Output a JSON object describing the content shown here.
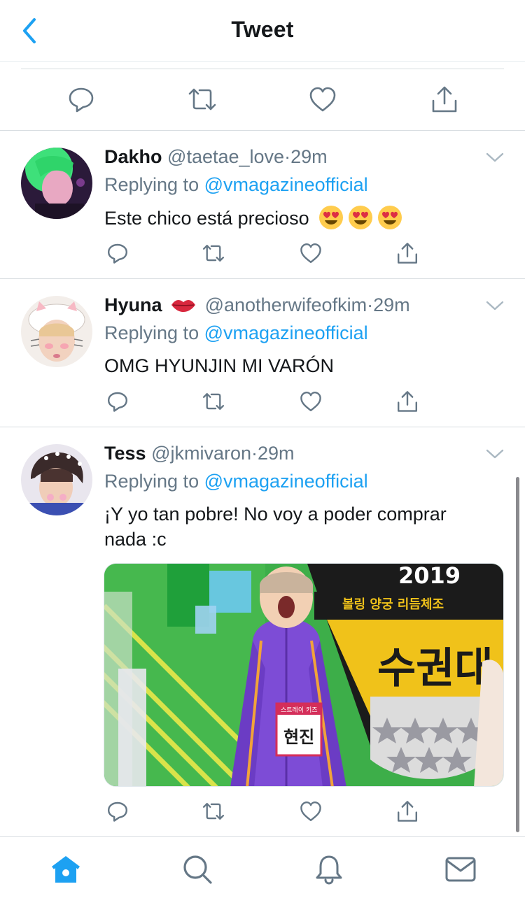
{
  "header": {
    "title": "Tweet"
  },
  "colors": {
    "accent": "#1da1f2",
    "muted": "#657786",
    "text": "#14171a",
    "divider": "#d8dde1"
  },
  "main_actions": [
    "reply-icon",
    "retweet-icon",
    "like-icon",
    "share-icon"
  ],
  "tweets": [
    {
      "name": "Dakho",
      "handle": "@taetae_love",
      "dot": "·",
      "time": "29m",
      "replying_prefix": "Replying to",
      "mention": "@vmagazineofficial",
      "text": "Este chico está precioso",
      "emojis": [
        "heart-eyes-emoji",
        "heart-eyes-emoji",
        "heart-eyes-emoji"
      ]
    },
    {
      "name": "Hyuna",
      "name_emoji": "lips-emoji",
      "handle": "@anotherwifeofkim",
      "dot": "·",
      "time": "29m",
      "replying_prefix": "Replying to",
      "mention": "@vmagazineofficial",
      "text": "OMG HYUNJIN MI VARÓN"
    },
    {
      "name": "Tess",
      "handle": "@jkmivaron",
      "dot": "·",
      "time": "29m",
      "replying_prefix": "Replying to",
      "mention": "@vmagazineofficial",
      "text_line1": "¡Y yo tan pobre! No voy a poder comprar",
      "text_line2": "nada :c",
      "media": {
        "banner_year": "2019",
        "banner_subtitle": "볼링 양궁 리듬체조 ",
        "banner_big": "수권대",
        "nametag": "현진",
        "nametag_small": "스트레이 키즈"
      }
    }
  ],
  "tabbar": [
    "home-icon",
    "search-icon",
    "notifications-icon",
    "messages-icon"
  ]
}
